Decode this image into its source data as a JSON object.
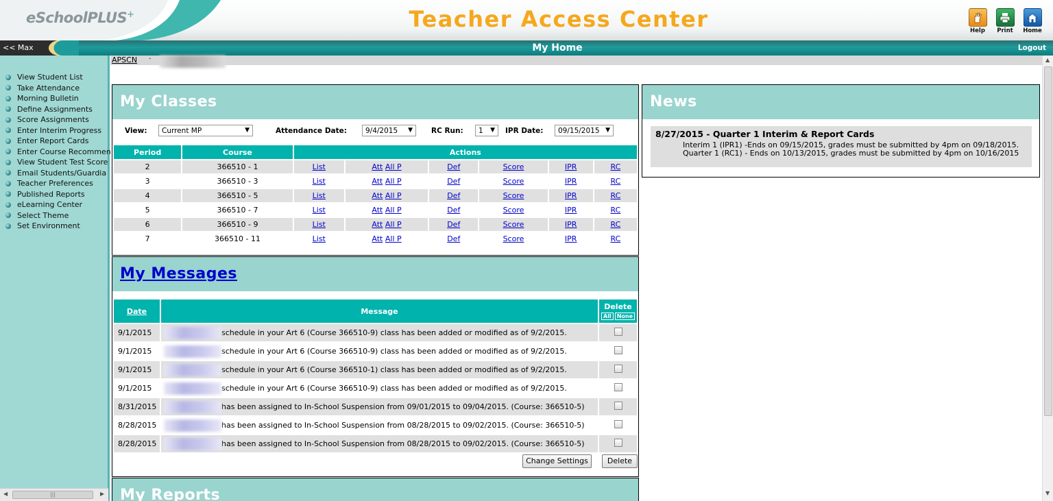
{
  "header": {
    "logo": "eSchoolPLUS",
    "logo_plus": "+",
    "title": "Teacher Access Center",
    "buttons": [
      {
        "label": "Help",
        "icon": "help-hand-icon",
        "color": "#f39a20"
      },
      {
        "label": "Print",
        "icon": "printer-icon",
        "color": "#1f8a3e"
      },
      {
        "label": "Home",
        "icon": "home-icon",
        "color": "#1a66b8"
      }
    ]
  },
  "navbar": {
    "max_label": "<< Max",
    "page_heading": "My Home",
    "logout_label": "Logout"
  },
  "breadcrumb": {
    "link": "APSCN",
    "separator": "·"
  },
  "sidebar": {
    "items": [
      {
        "label": "View Student List"
      },
      {
        "label": "Take Attendance"
      },
      {
        "label": "Morning Bulletin"
      },
      {
        "label": "Define Assignments"
      },
      {
        "label": "Score Assignments"
      },
      {
        "label": "Enter Interim Progress"
      },
      {
        "label": "Enter Report Cards"
      },
      {
        "label": "Enter Course Recommen"
      },
      {
        "label": "View Student Test Score"
      },
      {
        "label": "Email Students/Guardia"
      },
      {
        "label": "Teacher Preferences"
      },
      {
        "label": "Published Reports"
      },
      {
        "label": "eLearning Center"
      },
      {
        "label": "Select Theme"
      },
      {
        "label": "Set Environment"
      }
    ]
  },
  "my_classes": {
    "title": "My Classes",
    "filters": {
      "view_label": "View:",
      "view_value": "Current MP",
      "attendance_label": "Attendance Date:",
      "attendance_value": "9/4/2015",
      "rc_label": "RC Run:",
      "rc_value": "1",
      "ipr_label": "IPR Date:",
      "ipr_value": "09/15/2015"
    },
    "columns": {
      "period": "Period",
      "course": "Course",
      "actions": "Actions"
    },
    "action_labels": {
      "list": "List",
      "att": "Att",
      "allp": "All P",
      "def": "Def",
      "score": "Score",
      "ipr": "IPR",
      "rc": "RC"
    },
    "rows": [
      {
        "period": "2",
        "course": "366510 - 1"
      },
      {
        "period": "3",
        "course": "366510 - 3"
      },
      {
        "period": "4",
        "course": "366510 - 5"
      },
      {
        "period": "5",
        "course": "366510 - 7"
      },
      {
        "period": "6",
        "course": "366510 - 9"
      },
      {
        "period": "7",
        "course": "366510 - 11"
      }
    ]
  },
  "my_messages": {
    "title": "My Messages",
    "columns": {
      "date": "Date",
      "message": "Message",
      "delete": "Delete",
      "all": "All",
      "none": "None"
    },
    "rows": [
      {
        "date": "9/1/2015",
        "message": "schedule in your Art 6 (Course 366510-9) class has been added or modified as of 9/2/2015."
      },
      {
        "date": "9/1/2015",
        "message": "schedule in your Art 6 (Course 366510-9) class has been added or modified as of 9/2/2015."
      },
      {
        "date": "9/1/2015",
        "message": "schedule in your Art 6 (Course 366510-1) class has been added or modified as of 9/2/2015."
      },
      {
        "date": "9/1/2015",
        "message": "schedule in your Art 6 (Course 366510-9) class has been added or modified as of 9/2/2015."
      },
      {
        "date": "8/31/2015",
        "message": "has been assigned to In-School Suspension from 09/01/2015 to 09/04/2015. (Course: 366510-5)"
      },
      {
        "date": "8/28/2015",
        "message": "has been assigned to In-School Suspension from 08/28/2015 to 09/02/2015. (Course: 366510-5)"
      },
      {
        "date": "8/28/2015",
        "message": "has been assigned to In-School Suspension from 08/28/2015 to 09/02/2015. (Course: 366510-5)"
      }
    ],
    "change_settings_label": "Change Settings",
    "delete_label": "Delete"
  },
  "my_reports": {
    "title": "My Reports"
  },
  "news": {
    "title": "News",
    "item_title": "8/27/2015 - Quarter 1 Interim & Report Cards",
    "lines": [
      "Interim 1 (IPR1) -Ends on 09/15/2015, grades must be submitted by 4pm on 09/18/2015.",
      "Quarter 1 (RC1) - Ends on 10/13/2015, grades must be submitted by 4pm on 10/16/2015"
    ]
  }
}
